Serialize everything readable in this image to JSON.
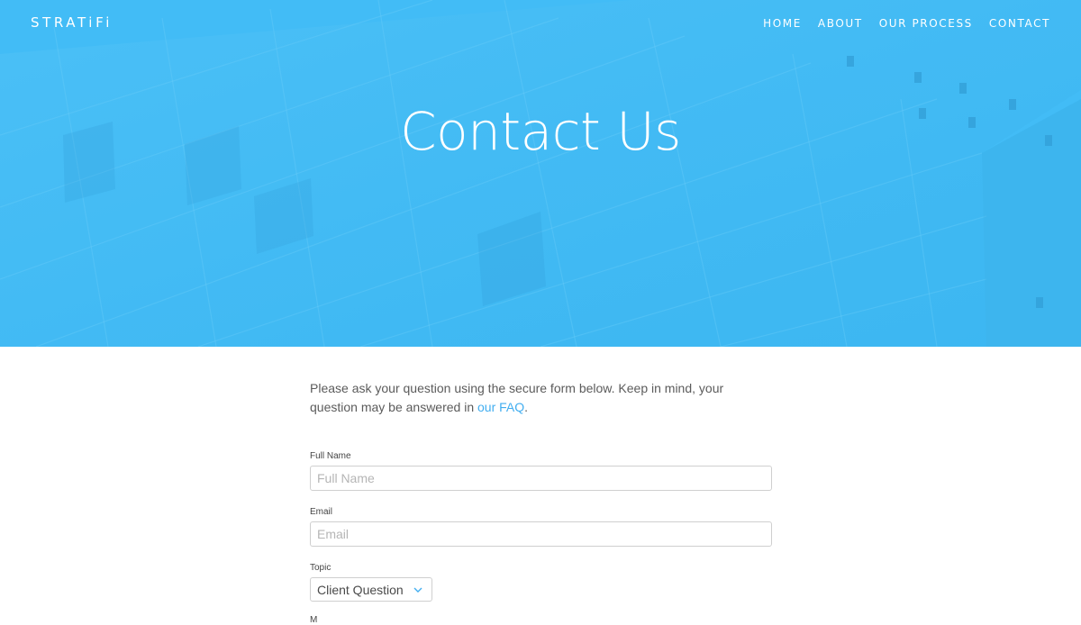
{
  "brand": "STRATiFi",
  "nav": {
    "items": [
      {
        "label": "HOME"
      },
      {
        "label": "ABOUT"
      },
      {
        "label": "OUR PROCESS"
      },
      {
        "label": "CONTACT"
      }
    ]
  },
  "hero": {
    "title": "Contact Us",
    "background_color": "#42bcf6"
  },
  "intro": {
    "text_before_link": "Please ask your question using the secure form below. Keep in mind, your question may be answered in ",
    "link_text": "our FAQ",
    "text_after_link": ".",
    "link_color": "#42aef0"
  },
  "form": {
    "full_name": {
      "label": "Full Name",
      "placeholder": "Full Name",
      "value": ""
    },
    "email": {
      "label": "Email",
      "placeholder": "Email",
      "value": ""
    },
    "topic": {
      "label": "Topic",
      "selected": "Client Question"
    },
    "next_label": "M"
  }
}
